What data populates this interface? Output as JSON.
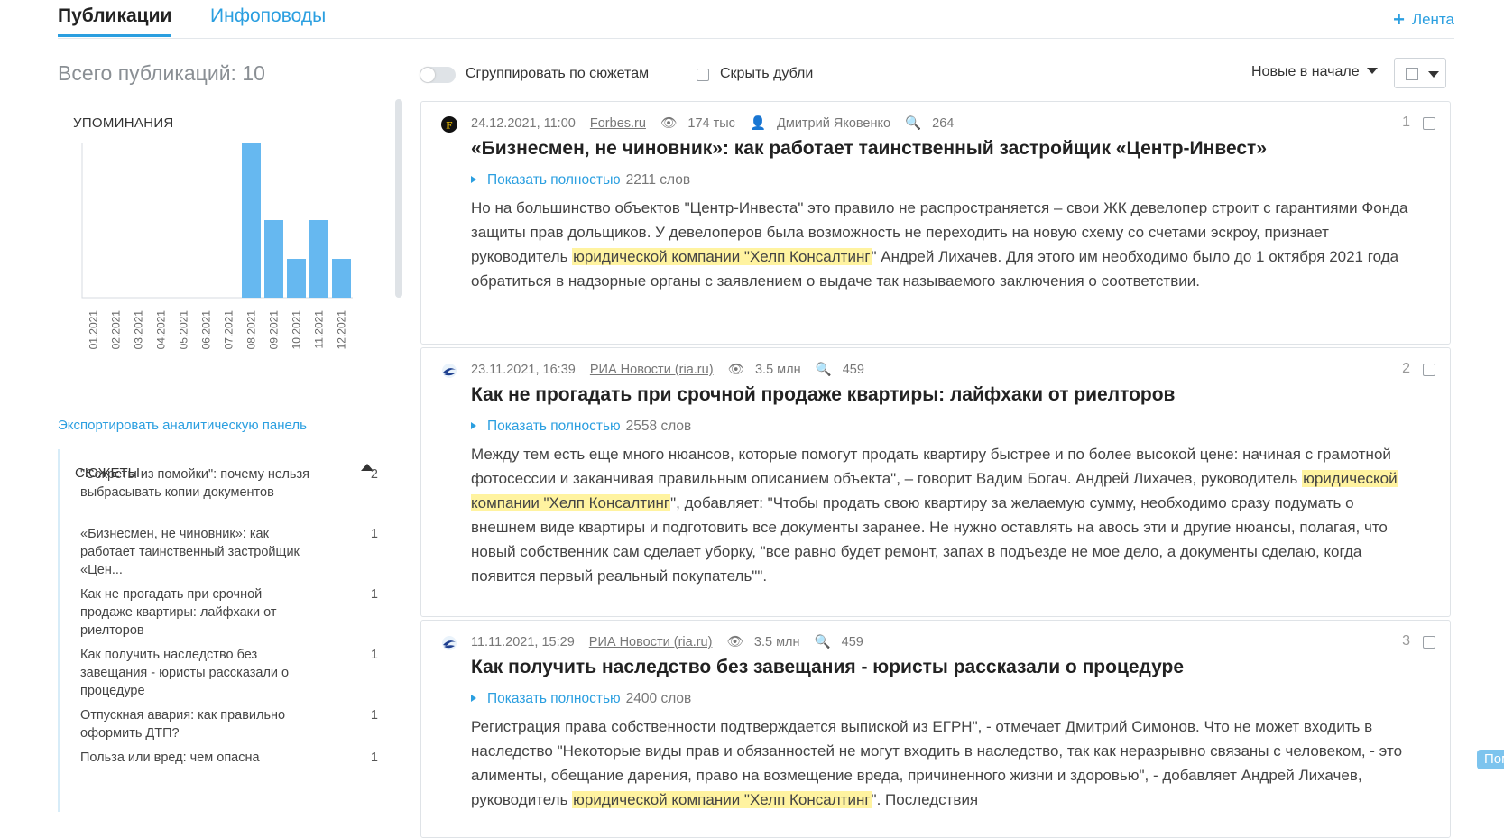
{
  "tabs": {
    "publications": "Публикации",
    "infopovody": "Инфоповоды",
    "feed_button": "Лента"
  },
  "total": "Всего публикаций: 10",
  "mentions": {
    "title": "УПОМИНАНИЯ",
    "export_link": "Экспортировать аналитическую панель"
  },
  "chart_data": {
    "type": "bar",
    "title": "УПОМИНАНИЯ",
    "categories": [
      "01.2021",
      "02.2021",
      "03.2021",
      "04.2021",
      "05.2021",
      "06.2021",
      "07.2021",
      "08.2021",
      "09.2021",
      "10.2021",
      "11.2021",
      "12.2021"
    ],
    "values": [
      0,
      0,
      0,
      0,
      0,
      0,
      0,
      4,
      2,
      1,
      2,
      1
    ],
    "ylim": [
      0,
      4
    ],
    "grid": false,
    "colors": {
      "bar": "#66b8f0",
      "axis": "#d7dbe0"
    }
  },
  "stories": {
    "title": "СЮЖЕТЫ",
    "items": [
      {
        "text": "\"Секреты из помойки\": почему нельзя выбрасывать копии документов",
        "count": "2"
      },
      {
        "text": "«Бизнесмен, не чиновник»: как работает таинственный застройщик «Цен...",
        "count": "1"
      },
      {
        "text": "Как не прогадать при срочной продаже квартиры: лайфхаки от риелторов",
        "count": "1"
      },
      {
        "text": "Как получить наследство без завещания - юристы рассказали о процедуре",
        "count": "1"
      },
      {
        "text": "Отпускная авария: как правильно оформить ДТП?",
        "count": "1"
      },
      {
        "text": "Польза или вред: чем опасна",
        "count": "1"
      }
    ]
  },
  "controls": {
    "group_label": "Сгруппировать по сюжетам",
    "hide_label": "Скрыть дубли",
    "sort_label": "Новые в начале"
  },
  "articles": [
    {
      "num": "1",
      "date": "24.12.2021, 11:00",
      "source": "Forbes.ru",
      "source_icon": "forbes-icon",
      "views": "174 тыс",
      "author": "Дмитрий Яковенко",
      "rank": "264",
      "title": "«Бизнесмен, не чиновник»: как работает таинственный застройщик «Центр-Инвест»",
      "show_full": "Показать полностью",
      "words": "2211 слов",
      "text_before": "Но на большинство объектов \"Центр-Инвеста\" это правило не распространяется – свои ЖК девелопер строит с гарантиями Фонда защиты прав дольщиков. У девелоперов была возможность не переходить на новую схему со счетами эскроу, признает руководитель ",
      "highlight": "юридической компании \"Хелп Консалтинг",
      "text_after": "\" Андрей Лихачев. Для этого им необходимо было до 1 октября 2021 года обратиться в надзорные органы с заявлением о выдаче так называемого заключения о соответствии."
    },
    {
      "num": "2",
      "date": "23.11.2021, 16:39",
      "source": "РИА Новости (ria.ru)",
      "source_icon": "ria-icon",
      "views": "3.5 млн",
      "rank": "459",
      "title": "Как не прогадать при срочной продаже квартиры: лайфхаки от риелторов",
      "show_full": "Показать полностью",
      "words": "2558 слов",
      "text_before": "Между тем есть еще много нюансов, которые помогут продать квартиру быстрее и по более высокой цене: начиная с грамотной фотосессии и заканчивая правильным описанием объекта\", – говорит Вадим Богач. Андрей Лихачев, руководитель ",
      "highlight": "юридической компании \"Хелп Консалтинг",
      "text_after": "\", добавляет: \"Чтобы продать свою квартиру за желаемую сумму, необходимо сразу подумать о внешнем виде квартиры и подготовить все документы заранее. Не нужно оставлять на авось эти и другие нюансы, полагая, что новый собственник сам сделает уборку, \"все равно будет ремонт, запах в подъезде не мое дело, а документы сделаю, когда появится первый реальный покупатель\"\"."
    },
    {
      "num": "3",
      "date": "11.11.2021, 15:29",
      "source": "РИА Новости (ria.ru)",
      "source_icon": "ria-icon",
      "views": "3.5 млн",
      "rank": "459",
      "title": "Как получить наследство без завещания - юристы рассказали о процедуре",
      "show_full": "Показать полностью",
      "words": "2400 слов",
      "text_before": "Регистрация права собственности подтверждается выпиской из ЕГРН\", - отмечает Дмитрий Симонов. Что не может входить в наследство \"Некоторые виды прав и обязанностей не могут входить в наследство, так как неразрывно связаны с человеком, - это алименты, обещание дарения, право на возмещение вреда, причиненного жизни и здоровью\", - добавляет Андрей Лихачев, руководитель ",
      "highlight": "юридической компании \"Хелп Консалтинг",
      "text_after": "\". Последствия"
    }
  ],
  "help_button": "Пом"
}
